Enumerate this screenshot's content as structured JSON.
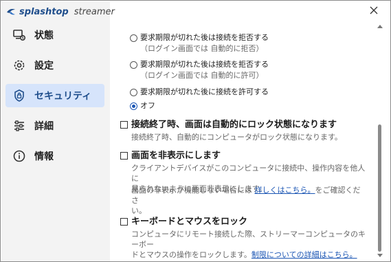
{
  "app": {
    "brand_primary": "splashtop",
    "brand_secondary": "streamer",
    "brand_color": "#1f4e8c",
    "accent_color": "#1a55b4"
  },
  "window": {
    "close_icon": "close-icon"
  },
  "sidebar": {
    "items": [
      {
        "label": "状態",
        "icon": "monitor-status-icon",
        "active": false
      },
      {
        "label": "設定",
        "icon": "gear-icon",
        "active": false
      },
      {
        "label": "セキュリティ",
        "icon": "lock-icon",
        "active": true
      },
      {
        "label": "詳細",
        "icon": "sliders-icon",
        "active": false
      },
      {
        "label": "情報",
        "icon": "info-icon",
        "active": false
      }
    ]
  },
  "security": {
    "request_options": [
      {
        "label": "要求期限が切れた後は接続を拒否する",
        "sub": "（ログイン画面では 自動的に拒否）",
        "selected": false
      },
      {
        "label": "要求期限が切れた後は接続を拒否する",
        "sub": "（ログイン画面では 自動的に許可）",
        "selected": false
      },
      {
        "label": "要求期限が切れた後に接続を許可する",
        "sub": "",
        "selected": false
      },
      {
        "label": "オフ",
        "sub": "",
        "selected": true
      }
    ],
    "lock_on_end": {
      "title": "接続終了時、画面は自動的にロック状態になります",
      "desc": "接続終了時、自動的にコンピュータがロック状態になります。",
      "checked": false
    },
    "hide_screen": {
      "title": "画面を非表示にします",
      "desc_line1": "クライアントデバイスがこのコンピュータに接続中、操作内容を他人に",
      "desc_line2": "見られないように画面非表示にします。",
      "note_prefix": "画面の非表示が機能しない場合には ",
      "note_link": "詳しくはこちら。",
      "note_suffix": "をご確認くださ",
      "note_line2": "い。",
      "checked": false
    },
    "lock_kb_mouse": {
      "title": "キーボードとマウスをロック",
      "desc_line1": "コンピュータにリモート接続した際、ストリーマーコンピュータのキーボー",
      "desc_line2_prefix": "ドとマウスの操作をロックします。",
      "desc_link": "制限についての詳細はこちら。",
      "checked": false
    }
  }
}
